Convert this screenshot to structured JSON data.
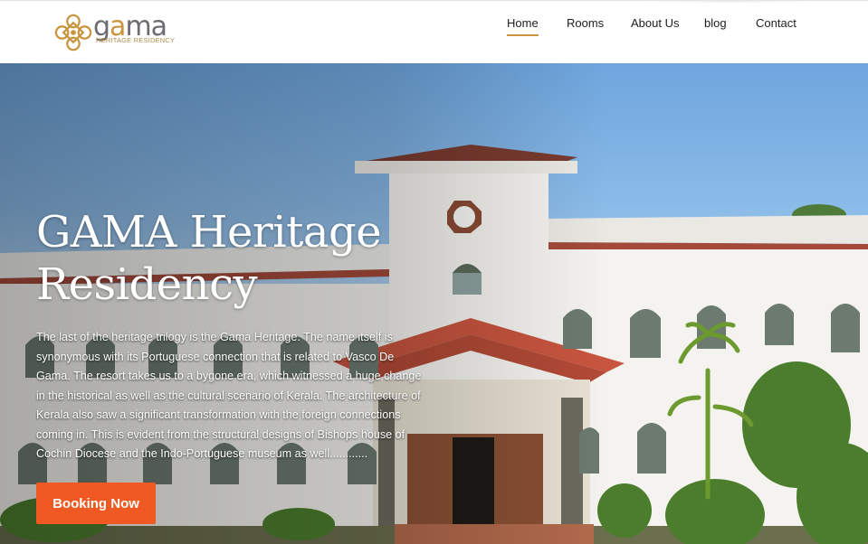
{
  "brand": {
    "logo_word_prefix": "g",
    "logo_word_accent": "a",
    "logo_word_suffix": "ma",
    "logo_subtitle": "HERITAGE RESIDENCY",
    "logo_mark_icon": "ornamental-flower-icon",
    "colors": {
      "gold": "#c9953f",
      "grey": "#6b6b70"
    }
  },
  "nav": {
    "items": [
      {
        "label": "Home",
        "active": true
      },
      {
        "label": "Rooms",
        "active": false
      },
      {
        "label": "About Us",
        "active": false
      },
      {
        "label": "blog",
        "active": false
      },
      {
        "label": "Contact",
        "active": false
      }
    ],
    "active_underline_color": "#c9953f"
  },
  "hero": {
    "title": "GAMA Heritage Residency",
    "description": "The last of the heritage trilogy is the Gama Heritage. The name itself is synonymous with its Portuguese connection that is related to Vasco De Gama. The resort takes us to a bygone era, which witnessed a huge change in the historical as well as the cultural scenario of  Kerala. The architecture of Kerala also saw a significant transformation with the foreign connections coming in. This is evident from the structural designs of Bishops house of Cochin Diocese and the Indo-Portuguese museum as well............",
    "cta_label": "Booking Now",
    "cta_color": "#f05a22",
    "background_image": "heritage-building-photo"
  }
}
